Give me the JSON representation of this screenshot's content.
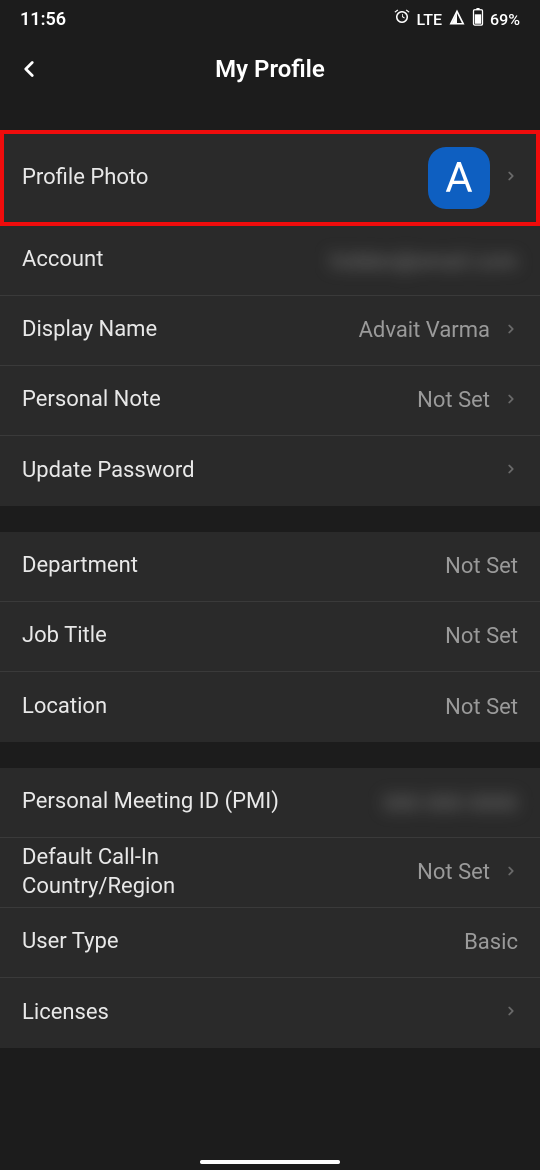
{
  "status": {
    "time": "11:56",
    "network": "LTE",
    "battery": "69%"
  },
  "header": {
    "title": "My Profile"
  },
  "sections": {
    "group1": {
      "profile_photo_label": "Profile Photo",
      "avatar_letter": "A",
      "account_label": "Account",
      "account_value_hidden": "hidden@email.com",
      "display_name_label": "Display Name",
      "display_name_value": "Advait Varma",
      "personal_note_label": "Personal Note",
      "personal_note_value": "Not Set",
      "update_password_label": "Update Password"
    },
    "group2": {
      "department_label": "Department",
      "department_value": "Not Set",
      "job_title_label": "Job Title",
      "job_title_value": "Not Set",
      "location_label": "Location",
      "location_value": "Not Set"
    },
    "group3": {
      "pmi_label": "Personal Meeting ID (PMI)",
      "pmi_value_hidden": "000 000 0000",
      "callin_label": "Default Call-In Country/Region",
      "callin_value": "Not Set",
      "user_type_label": "User Type",
      "user_type_value": "Basic",
      "licenses_label": "Licenses"
    }
  }
}
